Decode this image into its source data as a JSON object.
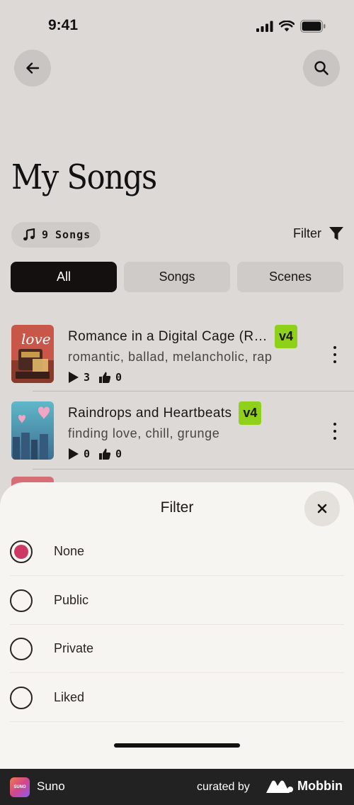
{
  "status_bar": {
    "time": "9:41"
  },
  "header": {
    "title": "My Songs"
  },
  "song_count": {
    "number": "9",
    "label": "Songs"
  },
  "filter": {
    "label": "Filter"
  },
  "tabs": [
    {
      "label": "All",
      "active": true
    },
    {
      "label": "Songs",
      "active": false
    },
    {
      "label": "Scenes",
      "active": false
    }
  ],
  "songs": [
    {
      "title": "Romance in a Digital Cage (R…",
      "version": "v4",
      "tags": "romantic, ballad, melancholic, rap",
      "plays": "3",
      "likes": "0",
      "cover_text": "love"
    },
    {
      "title": "Raindrops and Heartbeats",
      "version": "v4",
      "tags": "finding love, chill, grunge",
      "plays": "0",
      "likes": "0"
    }
  ],
  "sheet": {
    "title": "Filter",
    "options": [
      {
        "label": "None",
        "selected": true
      },
      {
        "label": "Public",
        "selected": false
      },
      {
        "label": "Private",
        "selected": false
      },
      {
        "label": "Liked",
        "selected": false
      }
    ]
  },
  "footer": {
    "app_name": "Suno",
    "app_icon_text": "SUNO",
    "curated_by": "curated by",
    "brand": "Mobbin"
  },
  "colors": {
    "accent_radio": "#cc3a63",
    "version_badge": "#8fd11a",
    "active_tab": "#141010"
  }
}
